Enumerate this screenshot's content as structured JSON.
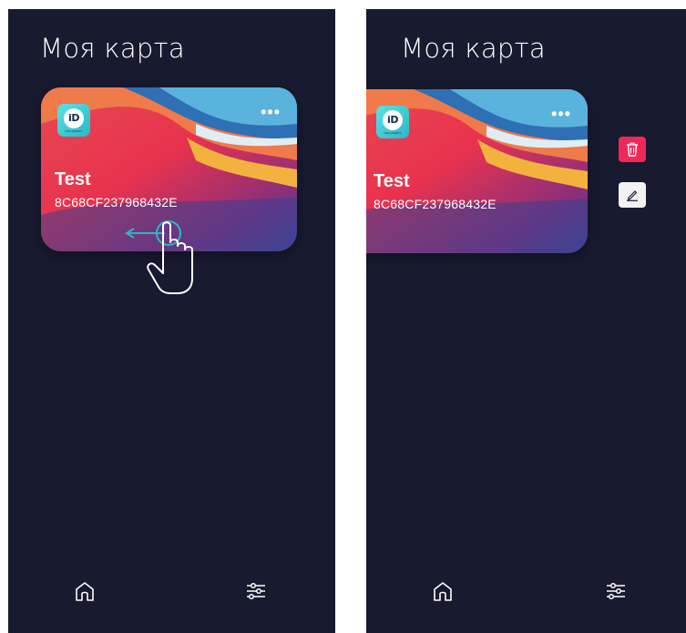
{
  "screens": [
    {
      "title": "Моя карта",
      "card": {
        "name": "Test",
        "number": "8C68CF237968432E",
        "logo_text": "iD",
        "logo_subtext": "DOCUMENT",
        "menu_icon": "more-icon"
      },
      "gesture": {
        "icon": "swipe-left-hand-icon"
      },
      "nav": {
        "home_icon": "home-icon",
        "settings_icon": "sliders-icon"
      }
    },
    {
      "title": "Моя карта",
      "card": {
        "name": "Test",
        "number": "8C68CF237968432E",
        "logo_text": "iD",
        "logo_subtext": "DOCUMENT",
        "menu_icon": "more-icon"
      },
      "actions": {
        "delete_icon": "trash-icon",
        "edit_icon": "pencil-icon"
      },
      "nav": {
        "home_icon": "home-icon",
        "settings_icon": "sliders-icon"
      }
    }
  ],
  "colors": {
    "background": "#181a30",
    "delete": "#f0285a",
    "edit": "#f2f2f2",
    "accent": "#2bb7c4"
  }
}
